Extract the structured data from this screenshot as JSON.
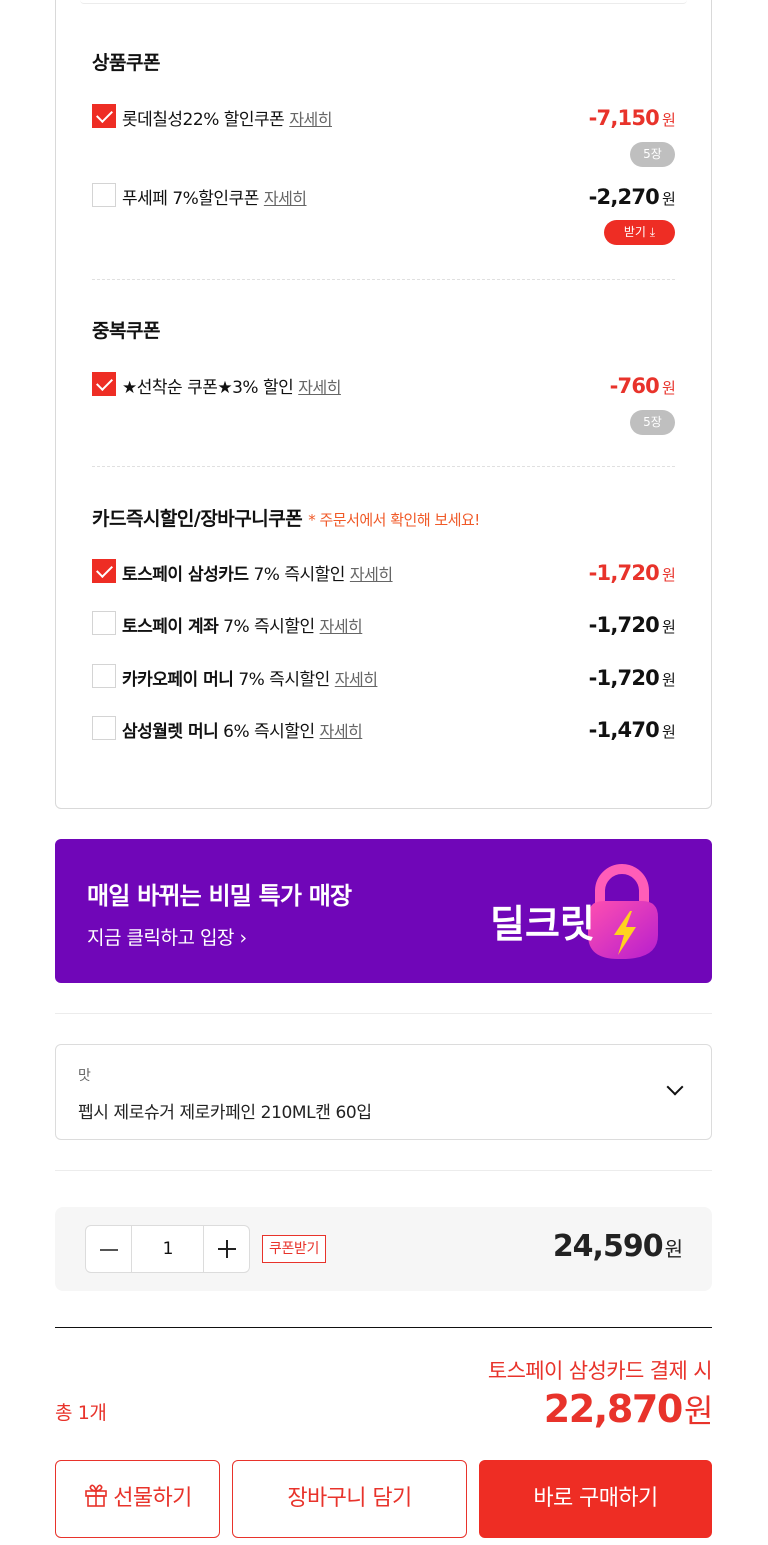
{
  "sections": {
    "product_coupon": {
      "title": "상품쿠폰",
      "items": [
        {
          "name": "롯데칠성22% 할인쿠폰",
          "detail": "자세히",
          "amount": "-7,150",
          "won": "원",
          "badge": "5장",
          "checked": true
        },
        {
          "name": "푸세페 7%할인쿠폰",
          "detail": "자세히",
          "amount": "-2,270",
          "won": "원",
          "badge": "받기 ⤓",
          "checked": false
        }
      ]
    },
    "duplicate_coupon": {
      "title": "중복쿠폰",
      "items": [
        {
          "name": "★선착순 쿠폰★3% 할인",
          "detail": "자세히",
          "amount": "-760",
          "won": "원",
          "badge": "5장",
          "checked": true
        }
      ]
    },
    "card_discount": {
      "title": "카드즉시할인/장바구니쿠폰",
      "note": "* 주문서에서 확인해 보세요!",
      "items": [
        {
          "brand": "토스페이 삼성카드",
          "desc": "7% 즉시할인",
          "detail": "자세히",
          "amount": "-1,720",
          "won": "원",
          "checked": true
        },
        {
          "brand": "토스페이 계좌",
          "desc": "7% 즉시할인",
          "detail": "자세히",
          "amount": "-1,720",
          "won": "원",
          "checked": false
        },
        {
          "brand": "카카오페이 머니",
          "desc": "7% 즉시할인",
          "detail": "자세히",
          "amount": "-1,720",
          "won": "원",
          "checked": false
        },
        {
          "brand": "삼성월렛 머니",
          "desc": "6% 즉시할인",
          "detail": "자세히",
          "amount": "-1,470",
          "won": "원",
          "checked": false
        }
      ]
    }
  },
  "banner": {
    "title": "매일 바뀌는 비밀 특가 매장",
    "subtitle": "지금 클릭하고 입장 ›",
    "logo_text": "딜크릿",
    "background": "#7006b8"
  },
  "option": {
    "label": "맛",
    "value": "펩시 제로슈거 제로카페인 210ML캔 60입"
  },
  "quantity": {
    "value": "1",
    "coupon_button": "쿠폰받기",
    "price": "24,590",
    "won": "원"
  },
  "summary": {
    "benefit_text": "토스페이 삼성카드 결제 시",
    "count": "총 1개",
    "total": "22,870",
    "won": "원"
  },
  "buttons": {
    "gift": "선물하기",
    "cart": "장바구니 담기",
    "buy": "바로 구매하기"
  },
  "colors": {
    "accent": "#ee2d24",
    "orange_note": "#f05a28"
  }
}
